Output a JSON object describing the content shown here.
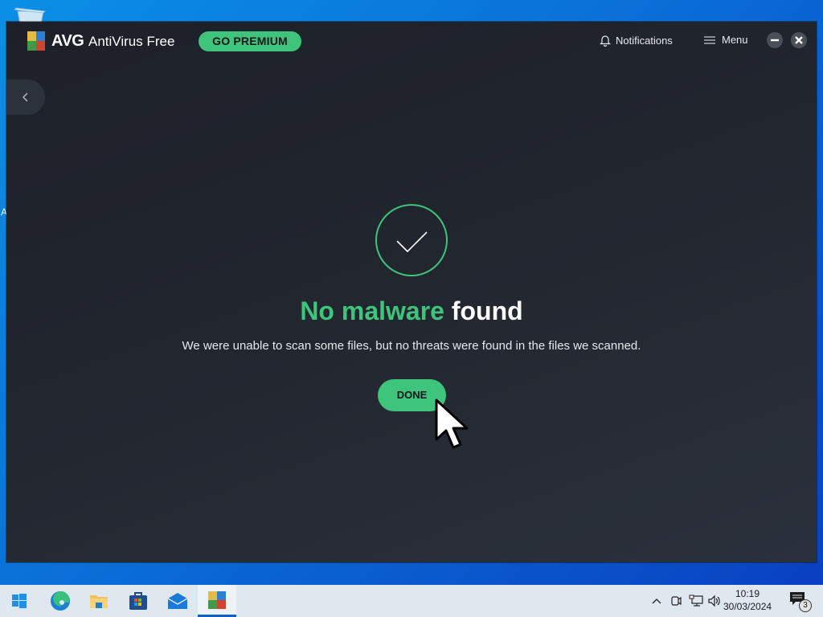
{
  "desktop": {
    "recycle_bin_icon": "recycle-bin-icon",
    "partial_label": "A"
  },
  "app": {
    "brand": "AVG",
    "product": "AntiVirus Free",
    "premium_button": "GO PREMIUM",
    "notifications_label": "Notifications",
    "menu_label": "Menu",
    "minimize_icon": "minimize-icon",
    "close_icon": "close-icon",
    "back_icon": "chevron-left-icon",
    "accent_color": "#3fc47b"
  },
  "result": {
    "headline_green": "No malware",
    "headline_white": "found",
    "message": "We were unable to scan some files, but no threats were found in the files we scanned.",
    "done_button": "DONE",
    "status_icon": "checkmark-icon"
  },
  "taskbar": {
    "items": [
      {
        "name": "start",
        "icon": "windows-logo-icon"
      },
      {
        "name": "edge",
        "icon": "edge-browser-icon"
      },
      {
        "name": "file-explorer",
        "icon": "folder-icon"
      },
      {
        "name": "microsoft-store",
        "icon": "store-icon"
      },
      {
        "name": "mail",
        "icon": "mail-icon"
      },
      {
        "name": "avg",
        "icon": "avg-logo-icon",
        "active": true
      }
    ],
    "tray": {
      "time": "10:19",
      "date": "30/03/2024",
      "notification_count": "3"
    }
  }
}
